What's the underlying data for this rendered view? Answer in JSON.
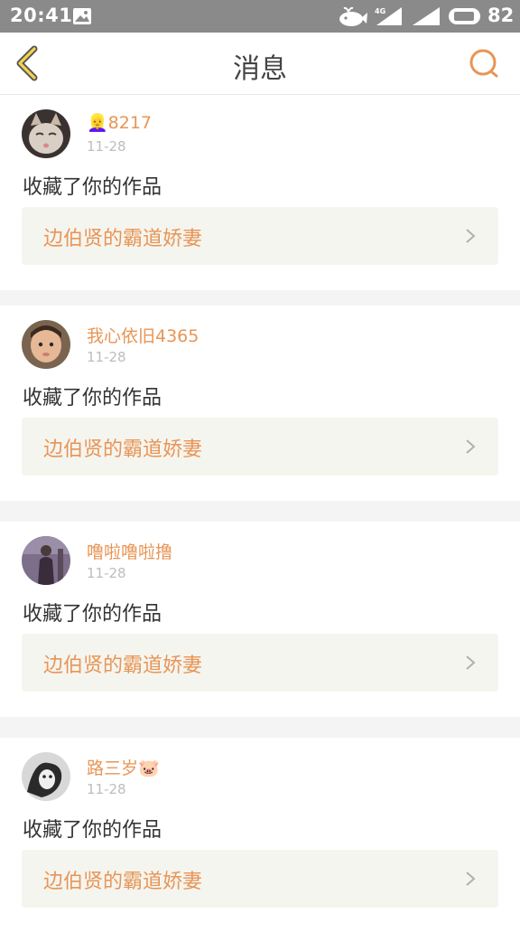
{
  "status_bar": {
    "time": "20:41",
    "battery": "82",
    "network": "4G",
    "icons": [
      "image-notification-icon",
      "whale-notification-icon",
      "cellular-4g-signal-icon",
      "cellular-signal-icon",
      "battery-icon"
    ]
  },
  "header": {
    "title": "消息",
    "back_icon": "back-chevron-icon",
    "search_icon": "search-icon"
  },
  "colors": {
    "accent": "#e89556",
    "status_bar_bg": "#8a8a8a",
    "card_bg": "#ffffff",
    "work_bg": "#f5f5ef",
    "divider": "#f4f4f4"
  },
  "messages": [
    {
      "username": "👱‍♀️8217",
      "date": "11-28",
      "action": "收藏了你的作品",
      "work_title": "边伯贤的霸道娇妻",
      "avatar": "cat-avatar"
    },
    {
      "username": "我心依旧4365",
      "date": "11-28",
      "action": "收藏了你的作品",
      "work_title": "边伯贤的霸道娇妻",
      "avatar": "baby-avatar"
    },
    {
      "username": "噜啦噜啦撸",
      "date": "11-28",
      "action": "收藏了你的作品",
      "work_title": "边伯贤的霸道娇妻",
      "avatar": "person-avatar"
    },
    {
      "username": "路三岁🐷",
      "date": "11-28",
      "action": "收藏了你的作品",
      "work_title": "边伯贤的霸道娇妻",
      "avatar": "bw-avatar"
    }
  ]
}
